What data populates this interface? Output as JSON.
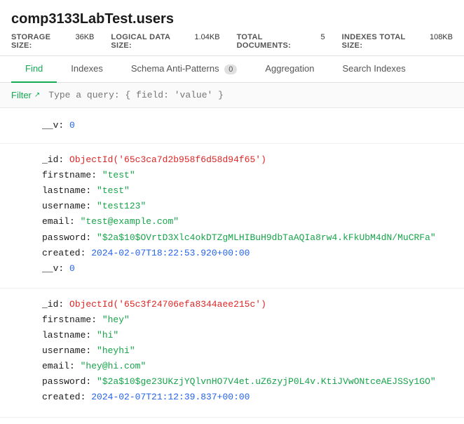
{
  "header": {
    "title": "comp3133LabTest.users",
    "meta": [
      {
        "label": "STORAGE SIZE:",
        "value": "36KB"
      },
      {
        "label": "LOGICAL DATA SIZE:",
        "value": "1.04KB"
      },
      {
        "label": "TOTAL DOCUMENTS:",
        "value": "5"
      },
      {
        "label": "INDEXES TOTAL SIZE:",
        "value": "108KB"
      }
    ]
  },
  "tabs": [
    {
      "label": "Find",
      "active": true,
      "badge": null
    },
    {
      "label": "Indexes",
      "active": false,
      "badge": null
    },
    {
      "label": "Schema Anti-Patterns",
      "active": false,
      "badge": "0"
    },
    {
      "label": "Aggregation",
      "active": false,
      "badge": null
    },
    {
      "label": "Search Indexes",
      "active": false,
      "badge": null
    }
  ],
  "filter": {
    "label": "Filter",
    "placeholder": "Type a query: { field: 'value' }"
  },
  "documents": [
    {
      "fields": [
        {
          "key": "__v:",
          "value": "0",
          "type": "number"
        }
      ]
    },
    {
      "fields": [
        {
          "key": "_id:",
          "value": "ObjectId('65c3ca7d2b958f6d58d94f65')",
          "type": "objectid"
        },
        {
          "key": "firstname:",
          "value": "\"test\"",
          "type": "string"
        },
        {
          "key": "lastname:",
          "value": "\"test\"",
          "type": "string"
        },
        {
          "key": "username:",
          "value": "\"test123\"",
          "type": "string"
        },
        {
          "key": "email:",
          "value": "\"test@example.com\"",
          "type": "string"
        },
        {
          "key": "password:",
          "value": "\"$2a$10$OVrtD3Xlc4okDTZgMLHIBuH9dbTaAQIa8rw4.kFkUbM4dN/MuCRFa\"",
          "type": "string"
        },
        {
          "key": "created:",
          "value": "2024-02-07T18:22:53.920+00:00",
          "type": "date"
        },
        {
          "key": "__v:",
          "value": "0",
          "type": "number"
        }
      ]
    },
    {
      "fields": [
        {
          "key": "_id:",
          "value": "ObjectId('65c3f24706efa8344aee215c')",
          "type": "objectid"
        },
        {
          "key": "firstname:",
          "value": "\"hey\"",
          "type": "string"
        },
        {
          "key": "lastname:",
          "value": "\"hi\"",
          "type": "string"
        },
        {
          "key": "username:",
          "value": "\"heyhi\"",
          "type": "string"
        },
        {
          "key": "email:",
          "value": "\"hey@hi.com\"",
          "type": "string"
        },
        {
          "key": "password:",
          "value": "\"$2a$10$ge23UKzjYQlvnHO7V4et.uZ6zyjP0L4v.KtiJVwONtceAEJSSy1GO\"",
          "type": "string"
        },
        {
          "key": "created:",
          "value": "2024-02-07T21:12:39.837+00:00",
          "type": "date"
        }
      ]
    }
  ]
}
